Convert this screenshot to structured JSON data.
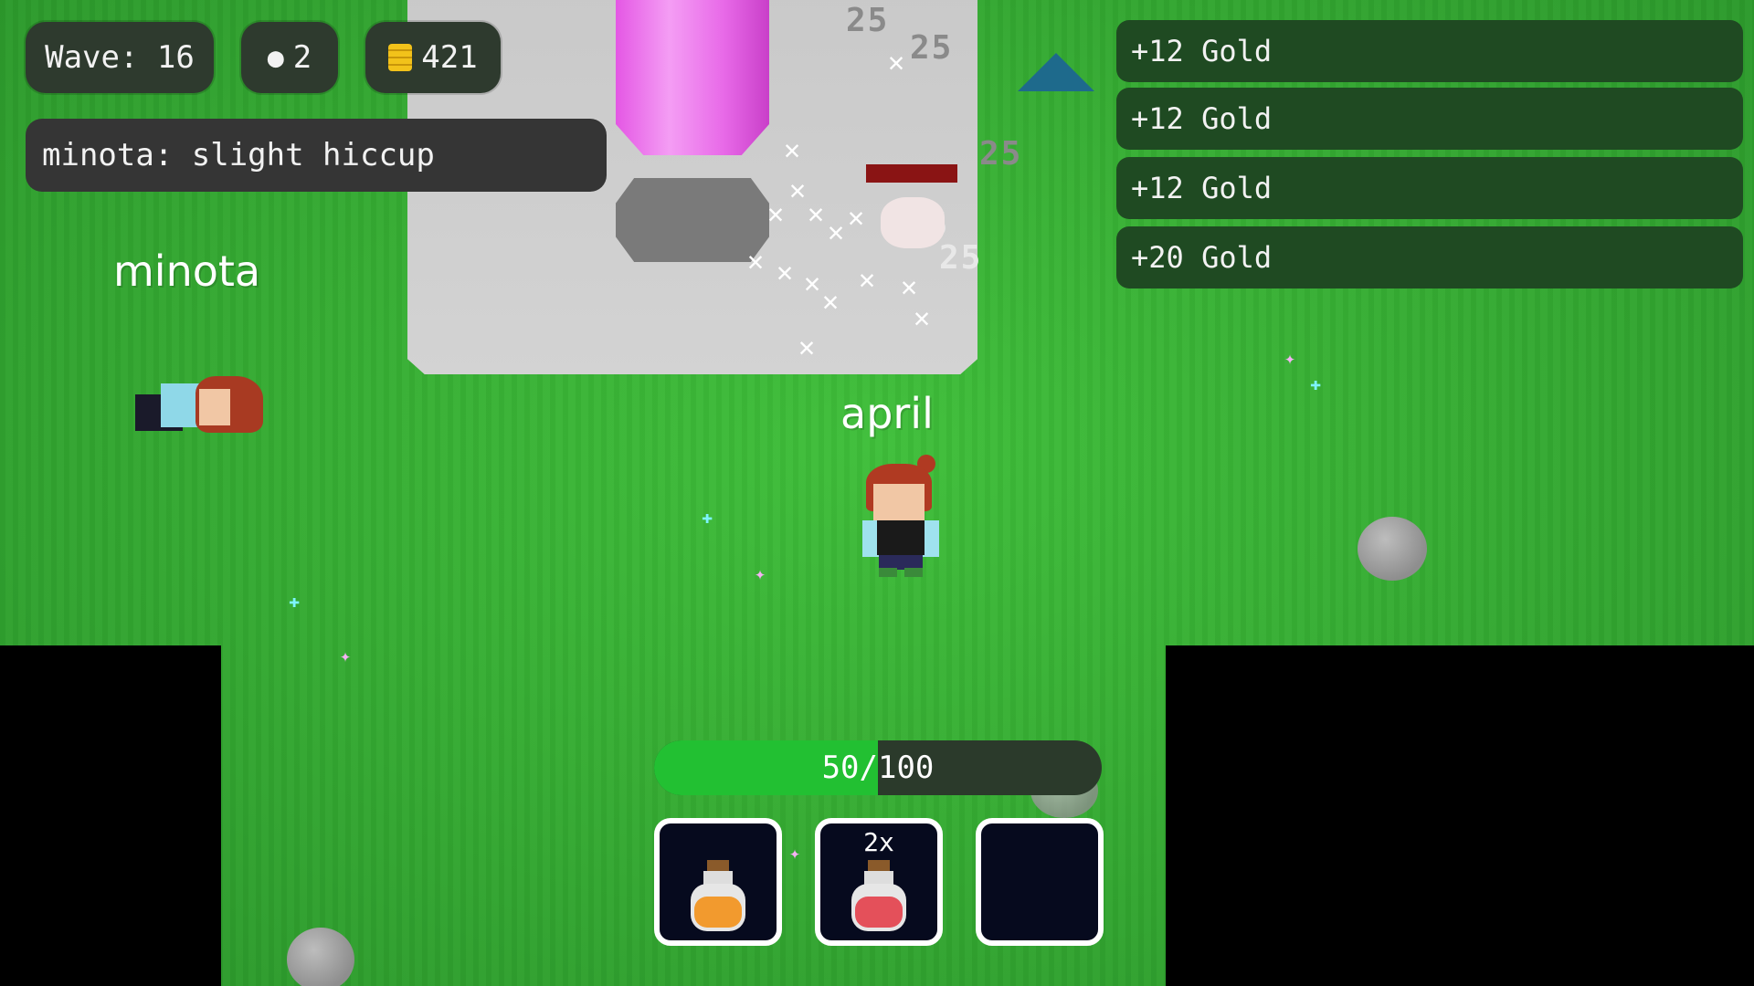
{
  "hud": {
    "wave_label": "Wave: 16",
    "bombs_count": "2",
    "gold_count": "421"
  },
  "chat": {
    "message": "minota: slight hiccup"
  },
  "notifications": [
    {
      "text": "+12 Gold"
    },
    {
      "text": "+12 Gold"
    },
    {
      "text": "+12 Gold"
    },
    {
      "text": "+20 Gold"
    }
  ],
  "damage_numbers": [
    "25",
    "25",
    "25",
    "25",
    "25"
  ],
  "players": {
    "other": "minota",
    "self": "april"
  },
  "health": {
    "text": "50/100",
    "current": 50,
    "max": 100
  },
  "inventory": {
    "slot1": {
      "item": "orange-potion"
    },
    "slot2": {
      "item": "red-potion",
      "qty": "2x"
    },
    "slot3": {
      "item": "empty"
    }
  },
  "colors": {
    "grass": "#36ad33",
    "health_fill": "#22c032",
    "crystal": "#f49df4",
    "notification_bg": "#1f4a22"
  },
  "icons": [
    "bomb-icon",
    "gold-coins-icon",
    "direction-arrow-icon"
  ]
}
